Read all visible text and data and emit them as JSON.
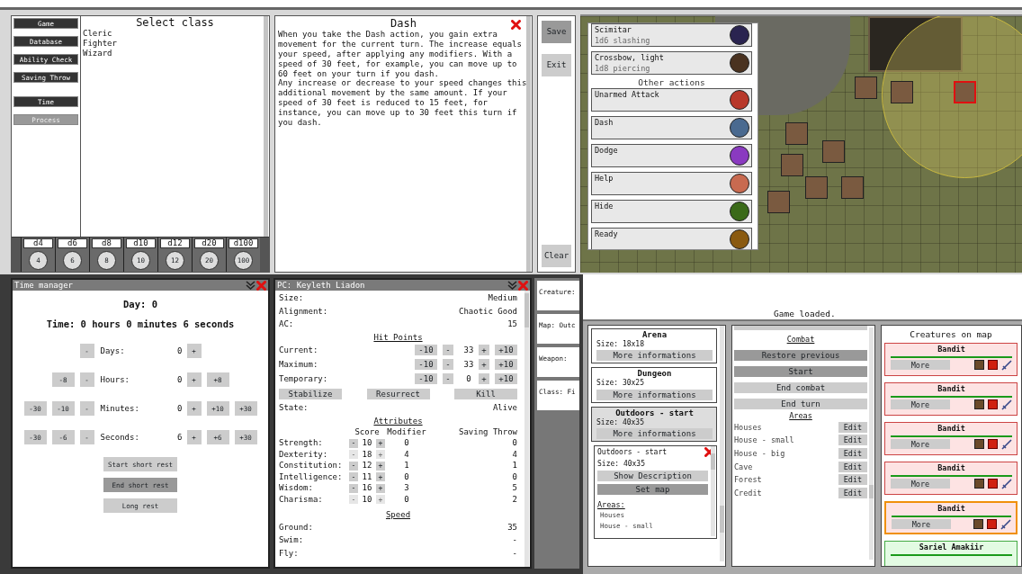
{
  "class_panel": {
    "menu_groups": [
      [
        {
          "label": "Game",
          "disabled": false
        },
        {
          "label": "Database",
          "disabled": false
        },
        {
          "label": "Ability Check",
          "disabled": false
        },
        {
          "label": "Saving Throw",
          "disabled": false
        }
      ],
      [
        {
          "label": "Time",
          "disabled": false
        },
        {
          "label": "Process",
          "disabled": true
        }
      ]
    ],
    "title": "Select class",
    "classes": [
      "Cleric",
      "Fighter",
      "Wizard"
    ],
    "dice": [
      {
        "label": "d4",
        "value": "4"
      },
      {
        "label": "d6",
        "value": "6"
      },
      {
        "label": "d8",
        "value": "8"
      },
      {
        "label": "d10",
        "value": "10"
      },
      {
        "label": "d12",
        "value": "12"
      },
      {
        "label": "d20",
        "value": "20"
      },
      {
        "label": "d100",
        "value": "100"
      }
    ]
  },
  "description_panel": {
    "title": "Dash",
    "paragraphs": [
      "When you take the Dash action, you gain extra movement for the current turn. The increase equals your speed, after applying any modifiers. With a speed of 30 feet, for example, you can move up to 60 feet on your turn if you dash.",
      "Any increase or decrease to your speed changes this additional movement by the same amount. If your speed of 30 feet is reduced to 15 feet, for instance, you can move up to 30 feet this turn if you dash."
    ]
  },
  "side_buttons_top": [
    {
      "label": "Save",
      "pressed": true
    },
    {
      "label": "Exit",
      "pressed": false
    }
  ],
  "side_buttons_bottom": [
    {
      "label": "Clear",
      "pressed": false
    }
  ],
  "map": {
    "tokens": [
      {
        "selected": false
      },
      {
        "selected": false
      },
      {
        "selected": true
      },
      {
        "selected": false
      },
      {
        "selected": false
      },
      {
        "selected": false
      },
      {
        "selected": false
      },
      {
        "selected": false
      },
      {
        "selected": false
      }
    ]
  },
  "actions": {
    "weapons": [
      {
        "name": "Scimitar",
        "detail": "1d6 slashing",
        "color": "#2a2450"
      },
      {
        "name": "Crossbow, light",
        "detail": "1d8 piercing",
        "color": "#4a3220"
      }
    ],
    "heading": "Other actions",
    "other": [
      {
        "name": "Unarmed Attack",
        "color": "#b8382a"
      },
      {
        "name": "Dash",
        "color": "#4a6a90"
      },
      {
        "name": "Dodge",
        "color": "#8a3ac0"
      },
      {
        "name": "Help",
        "color": "#c86a50"
      },
      {
        "name": "Hide",
        "color": "#3a6a18"
      },
      {
        "name": "Ready",
        "color": "#8a5a10"
      }
    ]
  },
  "time_manager": {
    "title": "Time manager",
    "day": "Day: 0",
    "time": "Time: 0 hours 0 minutes 6 seconds",
    "counters": [
      {
        "label": "Days:",
        "value": "0",
        "decrease": [
          "-"
        ],
        "increase": [
          "+"
        ]
      },
      {
        "label": "Hours:",
        "value": "0",
        "decrease": [
          "-8",
          "-"
        ],
        "increase": [
          "+",
          "+8"
        ]
      },
      {
        "label": "Minutes:",
        "value": "0",
        "decrease": [
          "-30",
          "-10",
          "-"
        ],
        "increase": [
          "+",
          "+10",
          "+30"
        ]
      },
      {
        "label": "Seconds:",
        "value": "6",
        "decrease": [
          "-30",
          "-6",
          "-"
        ],
        "increase": [
          "+",
          "+6",
          "+30"
        ]
      }
    ],
    "buttons": [
      {
        "label": "Start short rest",
        "pressed": false
      },
      {
        "label": "End short rest",
        "pressed": true
      },
      {
        "label": "Long rest",
        "pressed": false
      }
    ]
  },
  "pc_sheet": {
    "title": "PC: Keyleth Liadon",
    "info": [
      {
        "label": "Size:",
        "value": "Medium"
      },
      {
        "label": "Alignment:",
        "value": "Chaotic Good"
      },
      {
        "label": "AC:",
        "value": "15"
      }
    ],
    "hit_points": {
      "heading": "Hit Points",
      "rows": [
        {
          "label": "Current:",
          "value": "33",
          "decrease": [
            "-10",
            "-"
          ],
          "increase": [
            "+",
            "+10"
          ]
        },
        {
          "label": "Maximum:",
          "value": "33",
          "decrease": [
            "-10",
            "-"
          ],
          "increase": [
            "+",
            "+10"
          ]
        },
        {
          "label": "Temporary:",
          "value": "0",
          "decrease": [
            "-10",
            "-"
          ],
          "increase": [
            "+",
            "+10"
          ]
        }
      ],
      "buttons": [
        "Stabilize",
        "Resurrect",
        "Kill"
      ],
      "state_label": "State:",
      "state": "Alive"
    },
    "attributes": {
      "heading": "Attributes",
      "columns": [
        "Score",
        "Modifier",
        "Saving Throw"
      ],
      "rows": [
        {
          "name": "Strength:",
          "minus": "-",
          "score": "10",
          "plus": "+",
          "modifier": "0",
          "save": "0",
          "disabled": false
        },
        {
          "name": "Dexterity:",
          "minus": "-",
          "score": "18",
          "plus": "+",
          "modifier": "4",
          "save": "4",
          "disabled": true
        },
        {
          "name": "Constitution:",
          "minus": "-",
          "score": "12",
          "plus": "+",
          "modifier": "1",
          "save": "1",
          "disabled": false
        },
        {
          "name": "Intelligence:",
          "minus": "-",
          "score": "11",
          "plus": "+",
          "modifier": "0",
          "save": "0",
          "disabled": false
        },
        {
          "name": "Wisdom:",
          "minus": "-",
          "score": "16",
          "plus": "+",
          "modifier": "3",
          "save": "5",
          "disabled": false
        },
        {
          "name": "Charisma:",
          "minus": "-",
          "score": "10",
          "plus": "+",
          "modifier": "0",
          "save": "2",
          "disabled": true
        }
      ]
    },
    "speed": {
      "heading": "Speed",
      "rows": [
        {
          "label": "Ground:",
          "value": "35"
        },
        {
          "label": "Swim:",
          "value": "-"
        },
        {
          "label": "Fly:",
          "value": "-"
        }
      ]
    }
  },
  "info_column": [
    "Creature:",
    "Map: Outc",
    "Weapon:",
    "Class: Fi"
  ],
  "log": {
    "message": "Game loaded."
  },
  "maps": {
    "items": [
      {
        "name": "Arena",
        "size": "Size: 18x18",
        "button": "More informations",
        "selected": false
      },
      {
        "name": "Dungeon",
        "size": "Size: 30x25",
        "button": "More informations",
        "selected": false
      },
      {
        "name": "Outdoors - start",
        "size": "Size: 40x35",
        "button": "More informations",
        "selected": true
      }
    ],
    "detail": {
      "name": "Outdoors - start",
      "size": "Size: 40x35",
      "buttons": [
        {
          "label": "Show Description",
          "pressed": false
        },
        {
          "label": "Set map",
          "pressed": true
        }
      ],
      "areas_heading": "Areas:",
      "areas": [
        "Houses",
        "House - small"
      ]
    }
  },
  "combat": {
    "heading": "Combat",
    "buttons": [
      {
        "label": "Restore previous",
        "pressed": true
      },
      {
        "label": "Start",
        "pressed": true
      },
      {
        "label": "End combat",
        "pressed": false
      },
      {
        "label": "End turn",
        "pressed": false
      }
    ],
    "areas_heading": "Areas",
    "areas": [
      {
        "name": "Houses",
        "button": "Edit"
      },
      {
        "name": "House - small",
        "button": "Edit"
      },
      {
        "name": "House - big",
        "button": "Edit"
      },
      {
        "name": "Cave",
        "button": "Edit"
      },
      {
        "name": "Forest",
        "button": "Edit"
      },
      {
        "name": "Credit",
        "button": "Edit"
      }
    ]
  },
  "creatures": {
    "title": "Creatures on map",
    "items": [
      {
        "name": "Bandit",
        "kind": "enemy",
        "selected": false,
        "level": 1,
        "button": "More"
      },
      {
        "name": "Bandit",
        "kind": "enemy",
        "selected": false,
        "level": 1,
        "button": "More"
      },
      {
        "name": "Bandit",
        "kind": "enemy",
        "selected": false,
        "level": 1,
        "button": "More"
      },
      {
        "name": "Bandit",
        "kind": "enemy",
        "selected": false,
        "level": 1,
        "button": "More"
      },
      {
        "name": "Bandit",
        "kind": "enemy",
        "selected": true,
        "level": 1,
        "button": "More"
      },
      {
        "name": "Sariel Amakiir",
        "kind": "ally",
        "selected": false,
        "level": 1
      }
    ]
  }
}
